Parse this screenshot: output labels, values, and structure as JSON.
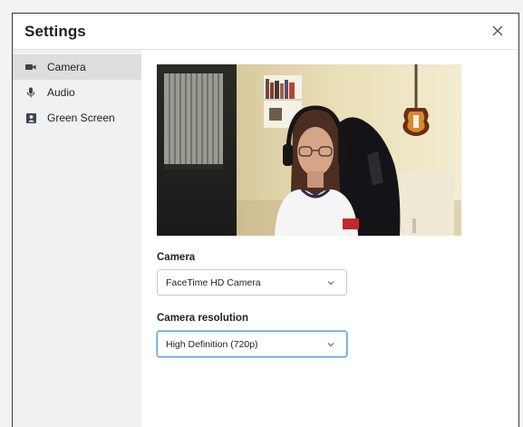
{
  "dialog": {
    "title": "Settings",
    "close_icon": "close-icon"
  },
  "sidebar": {
    "items": [
      {
        "label": "Camera",
        "icon": "video-camera-icon",
        "active": true
      },
      {
        "label": "Audio",
        "icon": "microphone-icon",
        "active": false
      },
      {
        "label": "Green Screen",
        "icon": "portrait-icon",
        "active": false
      }
    ]
  },
  "content": {
    "camera_label": "Camera",
    "camera_value": "FaceTime HD Camera",
    "resolution_label": "Camera resolution",
    "resolution_value": "High Definition (720p)"
  },
  "colors": {
    "sidebar_bg": "#f0f1f1",
    "active_item_bg": "#dcdddd",
    "focus_border": "#5aa0d8"
  }
}
